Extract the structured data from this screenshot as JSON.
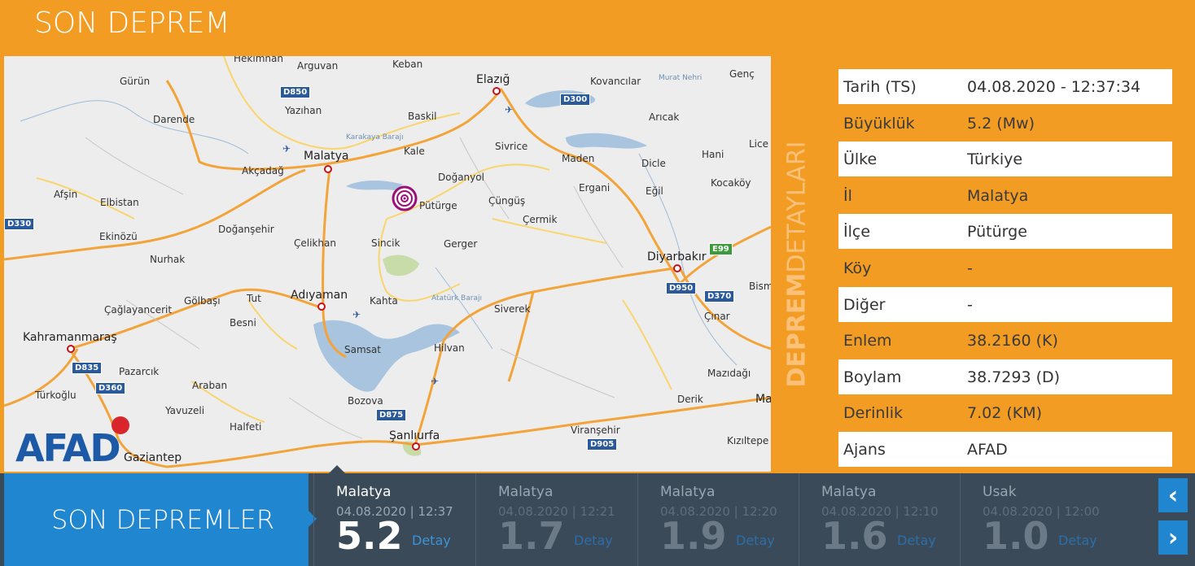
{
  "header": {
    "title": "SON DEPREM"
  },
  "panel": {
    "vertical_title_bold": "DEPREM",
    "vertical_title_light": "DETAYLARI"
  },
  "details": [
    {
      "key": "Tarih (TS)",
      "value": "04.08.2020 - 12:37:34"
    },
    {
      "key": "Büyüklük",
      "value": "5.2 (Mw)"
    },
    {
      "key": "Ülke",
      "value": "Türkiye"
    },
    {
      "key": "İl",
      "value": "Malatya"
    },
    {
      "key": "İlçe",
      "value": "Pütürge"
    },
    {
      "key": "Köy",
      "value": "-"
    },
    {
      "key": "Diğer",
      "value": "-"
    },
    {
      "key": "Enlem",
      "value": "38.2160 (K)"
    },
    {
      "key": "Boylam",
      "value": "38.7293 (D)"
    },
    {
      "key": "Derinlik",
      "value": "7.02 (KM)"
    },
    {
      "key": "Ajans",
      "value": "AFAD"
    }
  ],
  "map": {
    "logo": "AFAD",
    "labels": {
      "hekimhan": "Hekimhan",
      "arguvan": "Arguvan",
      "keban": "Keban",
      "elazig": "Elazığ",
      "kovancilar": "Kovancılar",
      "murat_nehri": "Murat Nehri",
      "genc": "Genç",
      "gurun": "Gürün",
      "yazihan": "Yazıhan",
      "baskil": "Baskil",
      "darende": "Darende",
      "aricak": "Arıcak",
      "karakaya": "Karakaya Barajı",
      "malatya": "Malatya",
      "kale": "Kale",
      "sivrice": "Sivrice",
      "maden": "Maden",
      "dicle": "Dicle",
      "hani": "Hani",
      "lice": "Lice",
      "akcadag": "Akçadağ",
      "doganyol": "Doğanyol",
      "kocakoy": "Kocaköy",
      "afsin": "Afşin",
      "elbistan": "Elbistan",
      "puturge": "Pütürge",
      "cungus": "Çüngüş",
      "ergani": "Ergani",
      "egil": "Eğil",
      "cermik": "Çermik",
      "dogansehir": "Doğanşehir",
      "ekinozu": "Ekinözü",
      "celikhan": "Çelikhan",
      "sincik": "Sincik",
      "gerger": "Gerger",
      "diyarbakir": "Diyarbakır",
      "nurhak": "Nurhak",
      "adiyaman": "Adıyaman",
      "kahta": "Kahta",
      "ataturk": "Atatürk Barajı",
      "golbasi": "Gölbaşı",
      "tut": "Tut",
      "caglayancerit": "Çağlayancerit",
      "siverek": "Siverek",
      "bism": "Bism",
      "cinar": "Çınar",
      "besni": "Besni",
      "kahramanmaras": "Kahramanmaraş",
      "samsat": "Samsat",
      "hilvan": "Hilvan",
      "pazarcik": "Pazarcık",
      "mazidagi": "Mazıdağı",
      "araban": "Araban",
      "turkoglu": "Türkoğlu",
      "bozova": "Bozova",
      "derik": "Derik",
      "yavuzeli": "Yavuzeli",
      "ma": "Ma",
      "halfeti": "Halfeti",
      "viransehir": "Viranşehir",
      "sanliurfa": "Şanlıurfa",
      "kiziltepe": "Kızıltepe",
      "gaziantep": "Gaziantep"
    },
    "shields": {
      "d850": "D850",
      "d300": "D300",
      "d330": "D330",
      "e99": "E99",
      "d950": "D950",
      "d370": "D370",
      "d835": "D835",
      "d360": "D360",
      "d875": "D875",
      "d905": "D905"
    }
  },
  "bottom": {
    "label": "SON DEPREMLER",
    "detail_label": "Detay",
    "quakes": [
      {
        "place": "Malatya",
        "time": "04.08.2020 | 12:37",
        "mag": "5.2"
      },
      {
        "place": "Malatya",
        "time": "04.08.2020 | 12:21",
        "mag": "1.7"
      },
      {
        "place": "Malatya",
        "time": "04.08.2020 | 12:20",
        "mag": "1.9"
      },
      {
        "place": "Malatya",
        "time": "04.08.2020 | 12:10",
        "mag": "1.6"
      },
      {
        "place": "Usak",
        "time": "04.08.2020 | 12:00",
        "mag": "1.0"
      }
    ],
    "prev_icon": "chevron-left-icon",
    "next_icon": "chevron-right-icon"
  }
}
